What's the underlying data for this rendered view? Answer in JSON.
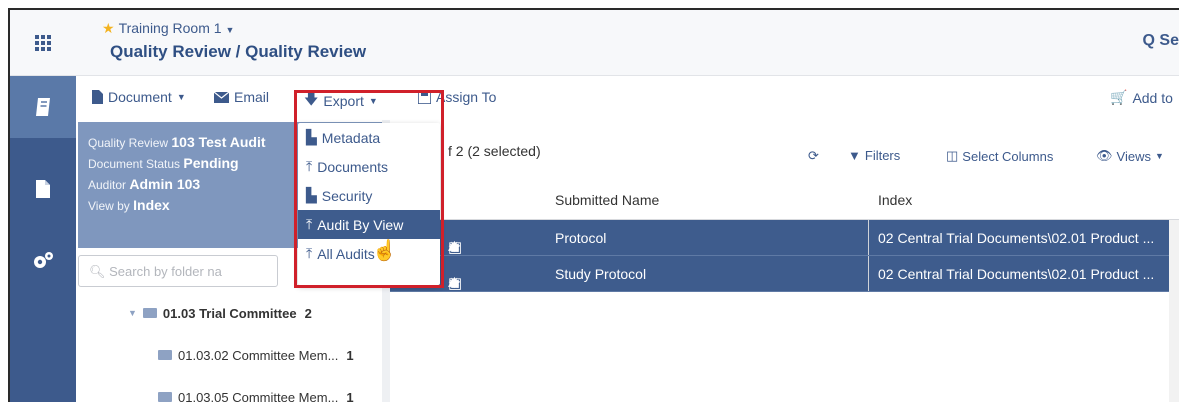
{
  "header": {
    "room": "Training Room 1",
    "breadcrumb": "Quality Review / Quality Review",
    "search_partial": "Q Se"
  },
  "toolbar": {
    "document": "Document",
    "email": "Email",
    "export": "Export",
    "assign": "Assign To",
    "add_to": "Add to"
  },
  "export_menu": {
    "items": [
      "Metadata",
      "Documents",
      "Security",
      "Audit By View",
      "All Audits"
    ]
  },
  "info": {
    "qr_label": "Quality Review",
    "qr_value": "103 Test Audit",
    "status_label": "Document Status",
    "status_value": "Pending",
    "auditor_label": "Auditor",
    "auditor_value": "Admin 103",
    "view_label": "View by",
    "view_value": "Index"
  },
  "folder_search": {
    "placeholder": "Search by folder na"
  },
  "tree": [
    {
      "label": "01.03 Trial Committee",
      "count": "2"
    },
    {
      "label": "01.03.02 Committee Mem...",
      "count": "1"
    },
    {
      "label": "01.03.05 Committee Mem...",
      "count": "1"
    }
  ],
  "grid": {
    "selection": "f 2 (2 selected)",
    "filters": "Filters",
    "select_columns": "Select Columns",
    "views": "Views",
    "columns": [
      "Submitted Name",
      "Index"
    ],
    "rows": [
      {
        "name": "Protocol",
        "index": "02 Central Trial Documents\\02.01 Product ..."
      },
      {
        "name": "Study Protocol",
        "index": "02 Central Trial Documents\\02.01 Product ..."
      }
    ]
  },
  "colors": {
    "rail": "#3d5a8c",
    "selected": "#3e5c8d",
    "info_panel": "#7f97be",
    "highlight_box": "#d0202a",
    "star": "#f3b321"
  }
}
